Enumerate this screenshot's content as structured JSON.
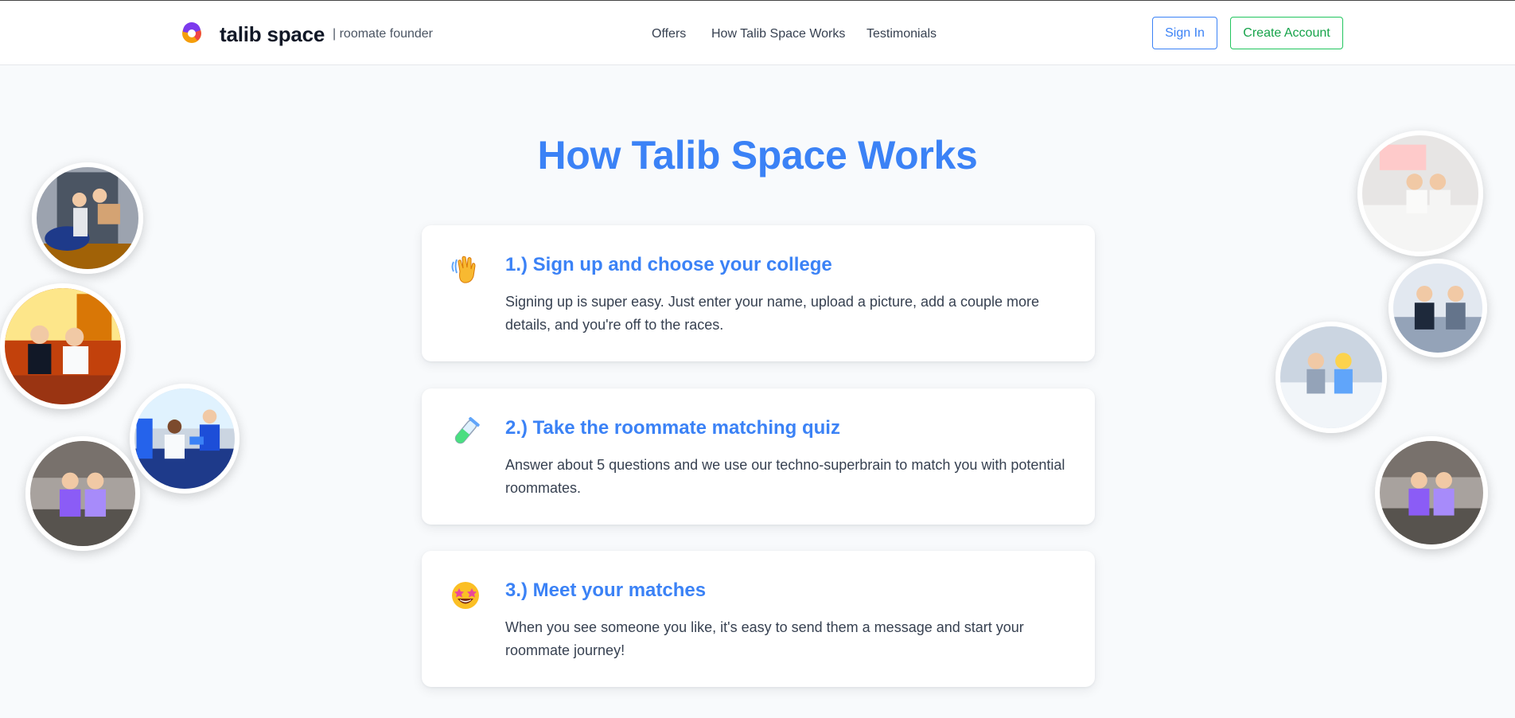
{
  "header": {
    "brand": "talib space",
    "tagline": "| roomate founder",
    "nav": [
      "Offers",
      "How Talib Space Works",
      "Testimonials"
    ],
    "sign_in": "Sign In",
    "create_account": "Create Account"
  },
  "main": {
    "title": "How Talib Space Works",
    "steps": [
      {
        "icon": "waving-hand-icon",
        "title": "1.) Sign up and choose your college",
        "body": "Signing up is super easy. Just enter your name, upload a picture, add a couple more details, and you're off to the races."
      },
      {
        "icon": "test-tube-icon",
        "title": "2.) Take the roommate matching quiz",
        "body": "Answer about 5 questions and we use our techno-superbrain to match you with potential roommates."
      },
      {
        "icon": "star-struck-face-icon",
        "title": "3.) Meet your matches",
        "body": "When you see someone you like, it's easy to send them a message and start your roommate journey!"
      }
    ]
  },
  "colors": {
    "accent_blue": "#3b82f6",
    "accent_green": "#22c55e",
    "background": "#f8fafc"
  }
}
